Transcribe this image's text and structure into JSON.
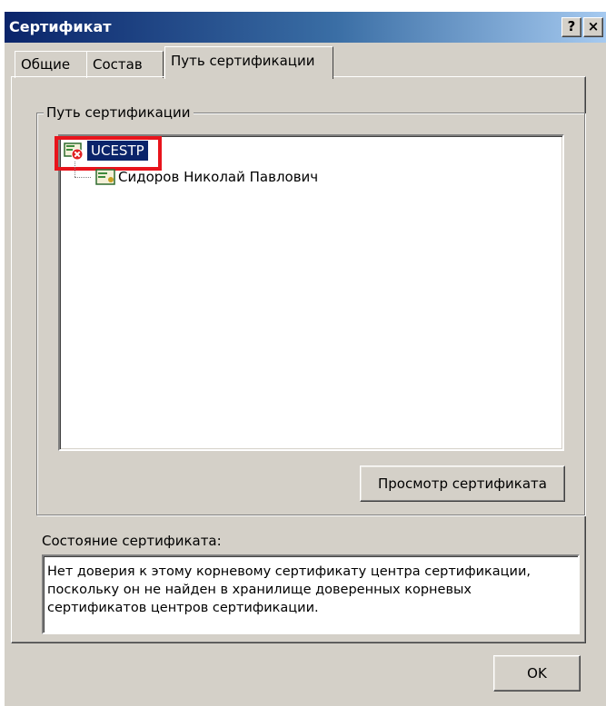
{
  "window": {
    "title": "Сертификат",
    "help_label": "?",
    "close_label": "×"
  },
  "tabs": [
    {
      "label": "Общие"
    },
    {
      "label": "Состав"
    },
    {
      "label": "Путь сертификации",
      "active": true
    }
  ],
  "cert_path": {
    "group_label": "Путь сертификации",
    "root": {
      "label": "UCESTP",
      "icon": "certificate-error-icon",
      "selected": true
    },
    "child": {
      "label": "Сидоров Николай Павлович",
      "icon": "certificate-icon"
    },
    "view_button_label": "Просмотр сертификата"
  },
  "status": {
    "label": "Состояние сертификата:",
    "text": "Нет доверия к этому корневому сертификату центра сертификации,\nпоскольку он не найден в хранилище доверенных корневых\nсертификатов центров сертификации."
  },
  "ok_button_label": "OK",
  "colors": {
    "highlight": "#0a246a",
    "annotation_red": "#e8141c",
    "dialog_face": "#d4d0c8"
  }
}
